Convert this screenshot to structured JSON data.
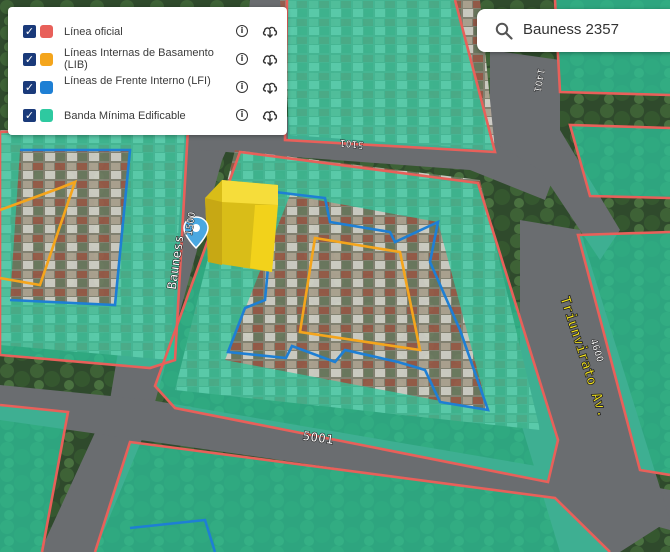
{
  "legend": {
    "items": [
      {
        "label": "Línea oficial",
        "color": "#e8605a",
        "checked": true,
        "info_icon": "info-icon",
        "download_icon": "cloud-download-icon"
      },
      {
        "label": "Líneas Internas de Basamento (LIB)",
        "color": "#f4a51c",
        "checked": true,
        "info_icon": "info-icon",
        "download_icon": "cloud-download-icon"
      },
      {
        "label": "Líneas de Frente Interno (LFI)",
        "color": "#1e7fd4",
        "checked": true,
        "info_icon": "info-icon",
        "download_icon": "cloud-download-icon"
      },
      {
        "label": "Banda Mínima Edificable",
        "color": "#2ec9a0",
        "checked": true,
        "info_icon": "info-icon",
        "download_icon": "cloud-download-icon"
      }
    ]
  },
  "search": {
    "value": "Bauness 2357",
    "icon": "search-icon"
  },
  "map": {
    "street_labels": {
      "bauness": "Bauness",
      "bauness_number": "1500",
      "triunvirato": "Triunvirato Av.",
      "triunvirato_number": "4600",
      "bottom_number": "5001",
      "top_number": "5101",
      "top_right_number": "1401"
    },
    "colors": {
      "linea_oficial": "#e8605a",
      "lib": "#f4a51c",
      "lfi": "#1e7fd4",
      "banda": "#2ec9a0",
      "building_3d": "#f2d21b",
      "pin": "#4aa8e0"
    }
  }
}
